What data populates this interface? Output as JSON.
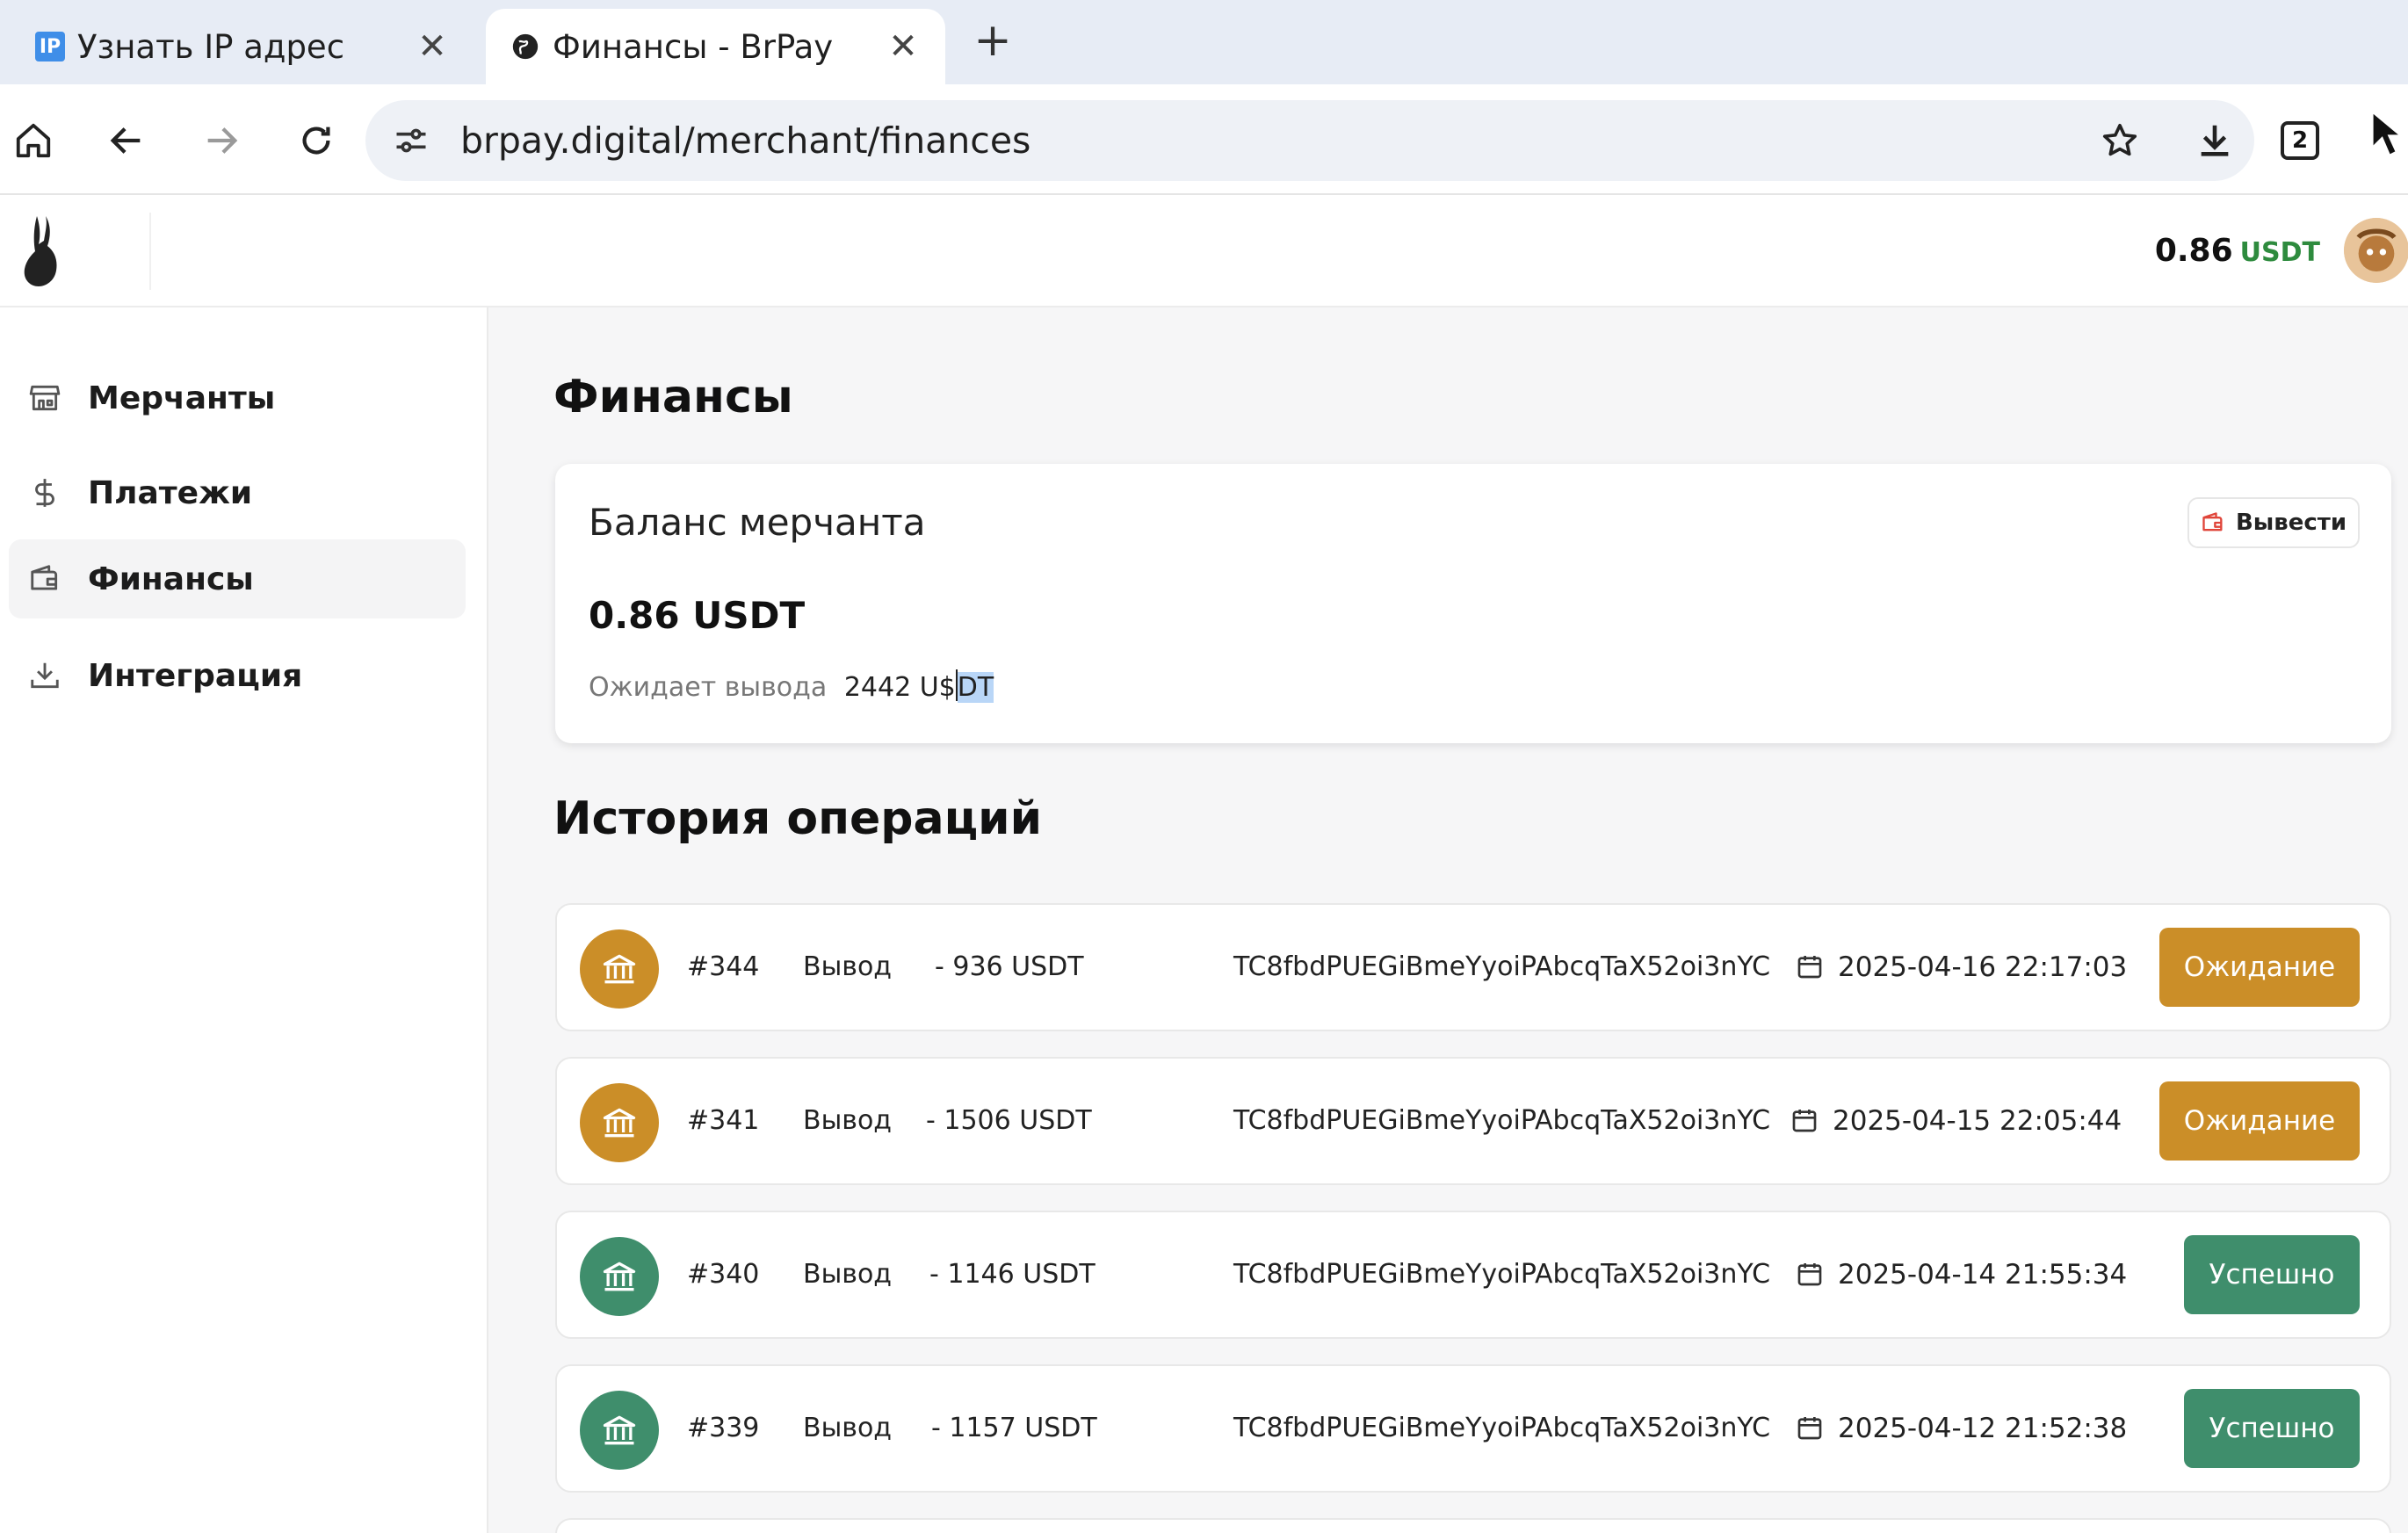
{
  "browser": {
    "tabs": [
      {
        "label": "Узнать IP адрес",
        "favicon": "ip-favicon",
        "favicon_text": "IP"
      },
      {
        "label": "Финансы - BrPay",
        "favicon": "globe-icon"
      }
    ],
    "url": "brpay.digital/merchant/finances",
    "tab_count": "2"
  },
  "header": {
    "balance": "0.86",
    "currency": "USDT"
  },
  "sidebar": {
    "items": [
      {
        "label": "Мерчанты",
        "icon": "store-icon"
      },
      {
        "label": "Платежи",
        "icon": "dollar-icon"
      },
      {
        "label": "Финансы",
        "icon": "wallet-icon",
        "active": true
      },
      {
        "label": "Интеграция",
        "icon": "download-icon"
      }
    ]
  },
  "page": {
    "title": "Финансы",
    "balance_card": {
      "title": "Баланс мерчанта",
      "withdraw_label": "Вывести",
      "amount": "0.86 USDT",
      "pending_label": "Ожидает вывода",
      "pending_value_pre": "2442 U",
      "pending_value_sel_a": "$",
      "pending_value_sel_b": "DT"
    },
    "history_title": "История операций",
    "operations": [
      {
        "id": "#344",
        "type": "Вывод",
        "amount": "- 936 USDT",
        "address": "TC8fbdPUEGiBmeYyoiPAbcqTaX52oi3nYC",
        "date": "2025-04-16 22:17:03",
        "status": "Ожидание",
        "status_kind": "pending"
      },
      {
        "id": "#341",
        "type": "Вывод",
        "amount": "- 1506 USDT",
        "address": "TC8fbdPUEGiBmeYyoiPAbcqTaX52oi3nYC",
        "date": "2025-04-15 22:05:44",
        "status": "Ожидание",
        "status_kind": "pending"
      },
      {
        "id": "#340",
        "type": "Вывод",
        "amount": "- 1146 USDT",
        "address": "TC8fbdPUEGiBmeYyoiPAbcqTaX52oi3nYC",
        "date": "2025-04-14 21:55:34",
        "status": "Успешно",
        "status_kind": "success"
      },
      {
        "id": "#339",
        "type": "Вывод",
        "amount": "- 1157 USDT",
        "address": "TC8fbdPUEGiBmeYyoiPAbcqTaX52oi3nYC",
        "date": "2025-04-12 21:52:38",
        "status": "Успешно",
        "status_kind": "success"
      }
    ]
  },
  "colors": {
    "pending": "#cb8e28",
    "success": "#3f8e6c",
    "currency_accent": "#2e8b3e"
  }
}
